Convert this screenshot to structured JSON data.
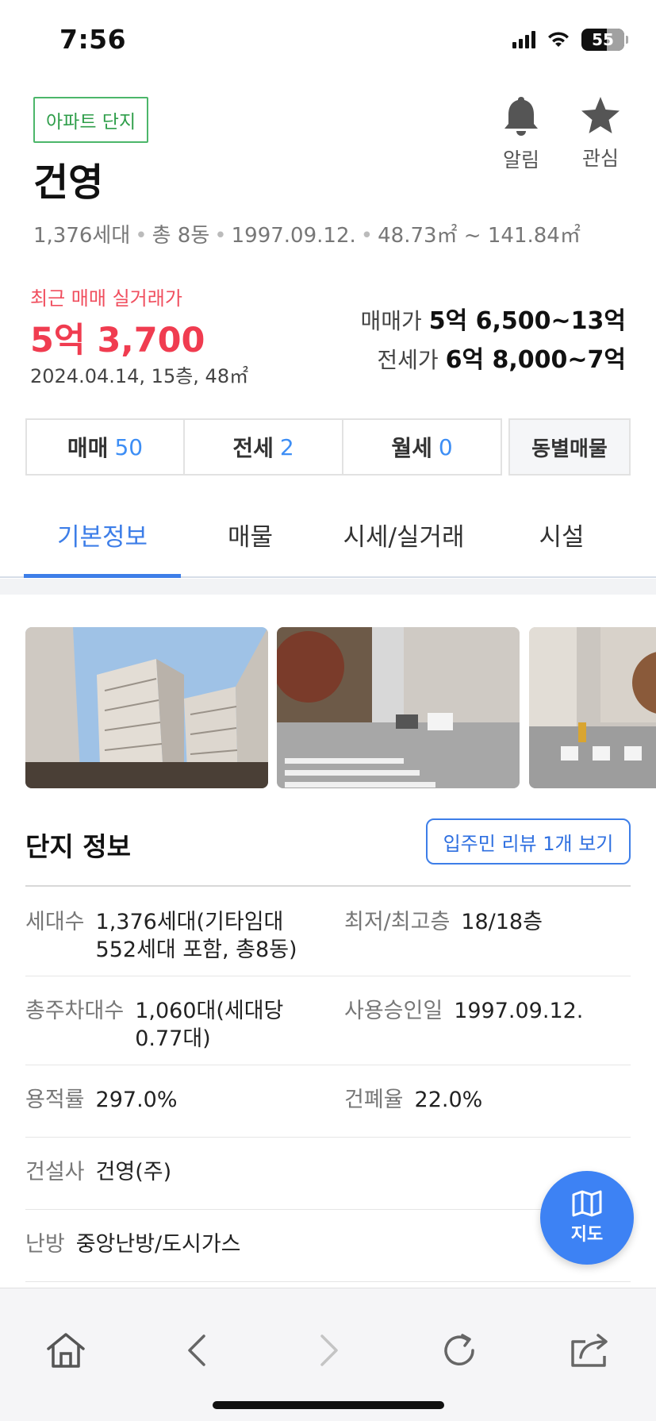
{
  "status_bar": {
    "time": "7:56",
    "battery": "55"
  },
  "header": {
    "badge": "아파트 단지",
    "name": "건영",
    "alarm_label": "알림",
    "favorite_label": "관심",
    "meta": {
      "households": "1,376세대",
      "buildings": "총 8동",
      "approval_date": "1997.09.12.",
      "area_range": "48.73㎡ ~ 141.84㎡"
    }
  },
  "price": {
    "recent_label": "최근 매매 실거래가",
    "recent_value": "5억 3,700",
    "recent_detail": "2024.04.14, 15층, 48㎡",
    "sale_label": "매매가",
    "sale_range": "5억 6,500~13억",
    "jeonse_label": "전세가",
    "jeonse_range": "6억 8,000~7억"
  },
  "listing_tabs": [
    {
      "label": "매매",
      "count": "50"
    },
    {
      "label": "전세",
      "count": "2"
    },
    {
      "label": "월세",
      "count": "0"
    }
  ],
  "building_listing_label": "동별매물",
  "main_tabs": [
    {
      "label": "기본정보",
      "active": true
    },
    {
      "label": "매물"
    },
    {
      "label": "시세/실거래"
    },
    {
      "label": "시설"
    }
  ],
  "info": {
    "title": "단지 정보",
    "review_button": "입주민 리뷰 1개 보기",
    "rows": [
      {
        "label": "세대수",
        "value": "1,376세대(기타임대 552세대 포함, 총8동)"
      },
      {
        "label": "최저/최고층",
        "value": "18/18층"
      },
      {
        "label": "총주차대수",
        "value": "1,060대(세대당 0.77대)"
      },
      {
        "label": "사용승인일",
        "value": "1997.09.12."
      },
      {
        "label": "용적률",
        "value": "297.0%"
      },
      {
        "label": "건폐율",
        "value": "22.0%"
      },
      {
        "label": "건설사",
        "value": "건영(주)"
      },
      {
        "label": "난방",
        "value": "중앙난방/도시가스"
      }
    ]
  },
  "map_button": "지도",
  "colors": {
    "accent": "#3d7ee8",
    "price_red": "#f03c50",
    "badge_green": "#4cb66a"
  }
}
